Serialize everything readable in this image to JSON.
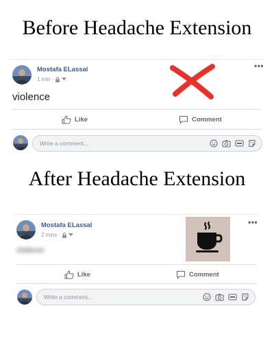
{
  "headings": {
    "before": "Before Headache Extension",
    "after": "After Headache Extension"
  },
  "post_before": {
    "author": "Mostafa ELassal",
    "time": "1 min",
    "body": "violence",
    "overlay_icon": "red-x-icon",
    "like_label": "Like",
    "comment_label": "Comment",
    "comment_placeholder": "Write a comment..."
  },
  "post_after": {
    "author": "Mostafa ELassal",
    "time": "2 mins",
    "body": "violence",
    "overlay_icon": "coffee-cup-icon",
    "like_label": "Like",
    "comment_label": "Comment",
    "comment_placeholder": "Write a comment..."
  },
  "colors": {
    "author_link": "#385898",
    "red_x": "#e8322a",
    "coffee_panel": "#d1c2bc"
  },
  "icons": [
    "globe-lock-icon",
    "more-dots-icon",
    "like-thumb-icon",
    "comment-bubble-icon",
    "emoji-icon",
    "camera-icon",
    "gif-icon",
    "sticker-icon"
  ]
}
